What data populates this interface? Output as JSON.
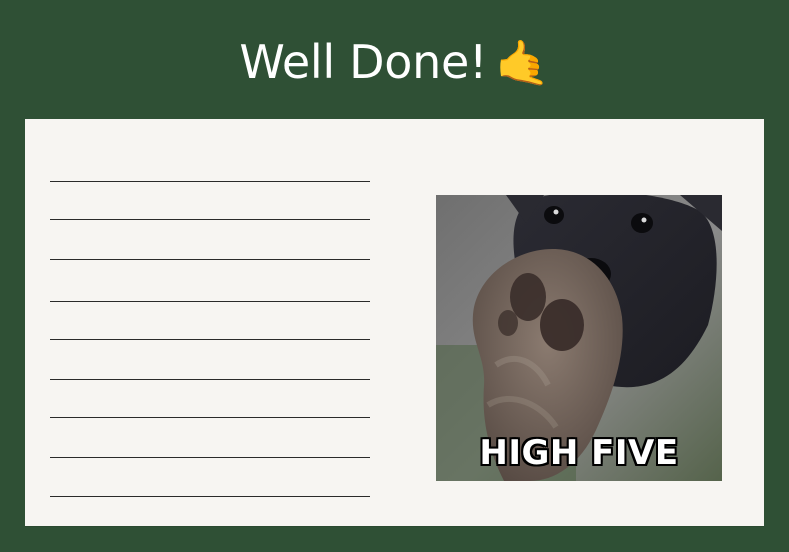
{
  "header": {
    "title": "Well Done!",
    "emoji": "🤙"
  },
  "card": {
    "image": {
      "alt": "Puppy giving a high five",
      "caption": "HIGH FIVE"
    },
    "lines_count": 9
  },
  "colors": {
    "background": "#2f5035",
    "card": "#f7f5f2",
    "line": "#2a2a2a",
    "title_text": "#ffffff"
  }
}
